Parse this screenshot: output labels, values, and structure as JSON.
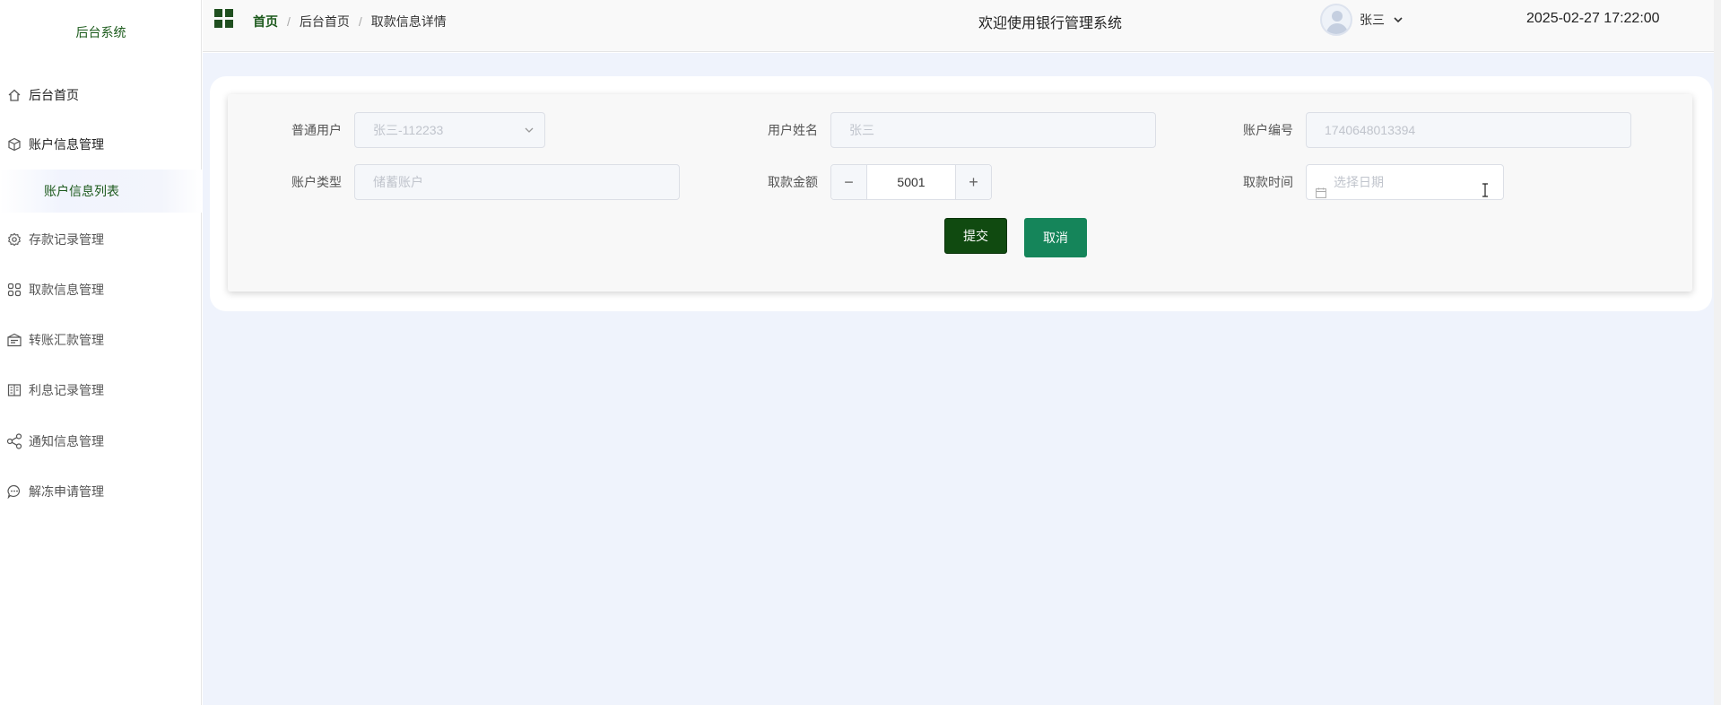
{
  "sidebar": {
    "brand": "后台系统",
    "items": [
      {
        "label": "后台首页",
        "icon": "home-icon"
      },
      {
        "label": "账户信息管理",
        "icon": "cube-icon"
      },
      {
        "label": "存款记录管理",
        "icon": "gear-icon"
      },
      {
        "label": "取款信息管理",
        "icon": "apps-icon"
      },
      {
        "label": "转账汇款管理",
        "icon": "bank-icon"
      },
      {
        "label": "利息记录管理",
        "icon": "book-icon"
      },
      {
        "label": "通知信息管理",
        "icon": "share-icon"
      },
      {
        "label": "解冻申请管理",
        "icon": "chat-icon"
      }
    ],
    "submenu": {
      "label": "账户信息列表"
    }
  },
  "header": {
    "breadcrumb": [
      "首页",
      "后台首页",
      "取款信息详情"
    ],
    "title": "欢迎使用银行管理系统",
    "user_name": "张三",
    "datetime": "2025-02-27 17:22:00"
  },
  "form": {
    "normal_user": {
      "label": "普通用户",
      "value": "张三-112233"
    },
    "user_name": {
      "label": "用户姓名",
      "value": "张三"
    },
    "account_no": {
      "label": "账户编号",
      "value": "1740648013394"
    },
    "account_type": {
      "label": "账户类型",
      "value": "储蓄账户"
    },
    "amount": {
      "label": "取款金额",
      "value": "5001",
      "minus": "−",
      "plus": "+"
    },
    "withdraw_time": {
      "label": "取款时间",
      "placeholder": "选择日期"
    },
    "submit_label": "提交",
    "cancel_label": "取消"
  },
  "colors": {
    "accent": "#1d5a1d",
    "submit": "#104a10",
    "cancel": "#15855a",
    "main_bg": "#eff3fc"
  }
}
